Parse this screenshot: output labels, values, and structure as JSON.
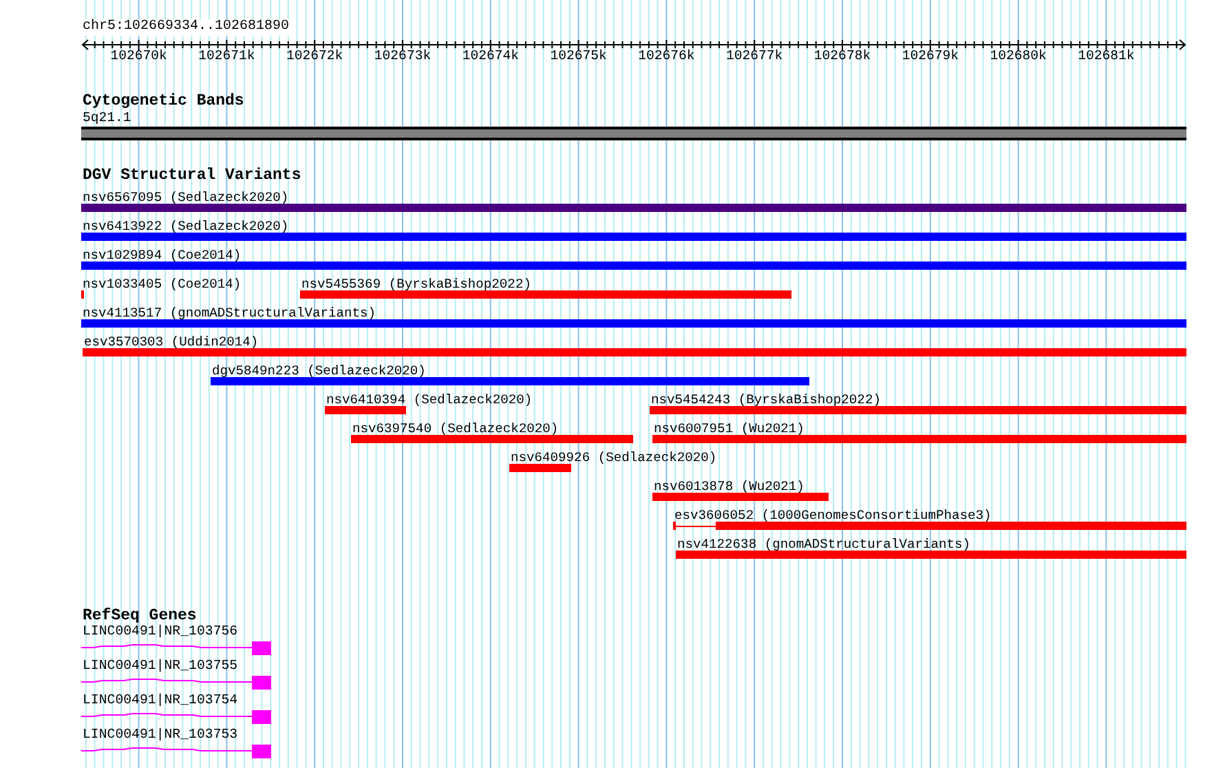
{
  "ruler": {
    "location": "chr5:102669334..102681890",
    "ticks": [
      "102670k",
      "102671k",
      "102672k",
      "102673k",
      "102674k",
      "102675k",
      "102676k",
      "102677k",
      "102678k",
      "102679k",
      "102680k",
      "102681k"
    ]
  },
  "cytobands": {
    "title": "Cytogenetic Bands",
    "bands": [
      {
        "label": "5q21.1"
      }
    ]
  },
  "variants": {
    "title": "DGV Structural Variants",
    "features": [
      {
        "label": "nsv6567095 (Sedlazeck2020)",
        "color": "#4b0082"
      },
      {
        "label": "nsv6413922 (Sedlazeck2020)",
        "color": "#0000ff"
      },
      {
        "label": "nsv1029894 (Coe2014)",
        "color": "#0000ff"
      },
      {
        "label": "nsv1033405 (Coe2014)",
        "color": "#ff0000"
      },
      {
        "label": "nsv5455369 (ByrskaBishop2022)",
        "color": "#ff0000"
      },
      {
        "label": "nsv4113517 (gnomADStructuralVariants)",
        "color": "#0000ff"
      },
      {
        "label": "esv3570303 (Uddin2014)",
        "color": "#ff0000"
      },
      {
        "label": "dgv5849n223 (Sedlazeck2020)",
        "color": "#0000ff"
      },
      {
        "label": "nsv6410394 (Sedlazeck2020)",
        "color": "#ff0000"
      },
      {
        "label": "nsv5454243 (ByrskaBishop2022)",
        "color": "#ff0000"
      },
      {
        "label": "nsv6397540 (Sedlazeck2020)",
        "color": "#ff0000"
      },
      {
        "label": "nsv6007951 (Wu2021)",
        "color": "#ff0000"
      },
      {
        "label": "nsv6409926 (Sedlazeck2020)",
        "color": "#ff0000"
      },
      {
        "label": "nsv6013878 (Wu2021)",
        "color": "#ff0000"
      },
      {
        "label": "esv3606052 (1000GenomesConsortiumPhase3)",
        "color": "#ff0000"
      },
      {
        "label": "nsv4122638 (gnomADStructuralVariants)",
        "color": "#ff0000"
      }
    ]
  },
  "genes": {
    "title": "RefSeq Genes",
    "features": [
      {
        "label": "LINC00491|NR_103756"
      },
      {
        "label": "LINC00491|NR_103755"
      },
      {
        "label": "LINC00491|NR_103754"
      },
      {
        "label": "LINC00491|NR_103753"
      }
    ]
  }
}
